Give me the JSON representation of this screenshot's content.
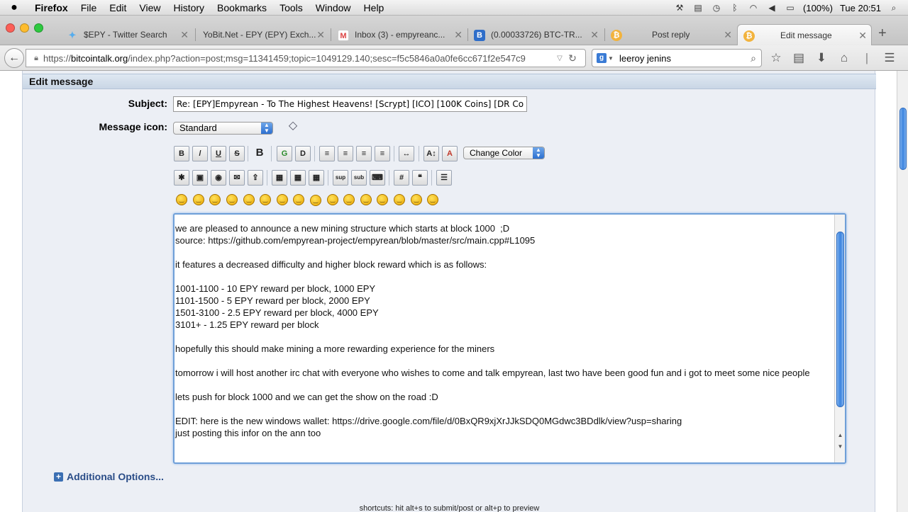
{
  "menubar": {
    "app": "Firefox",
    "items": [
      "File",
      "Edit",
      "View",
      "History",
      "Bookmarks",
      "Tools",
      "Window",
      "Help"
    ],
    "battery": "(100%)",
    "clock": "Tue 20:51"
  },
  "tabs": [
    {
      "label": "$EPY - Twitter Search",
      "icon": "twitter-bird-icon"
    },
    {
      "label": "YoBit.Net - EPY (EPY) Exch...",
      "icon": "none"
    },
    {
      "label": "Inbox (3) - empyreanc...",
      "icon": "gmail-icon"
    },
    {
      "label": "(0.00033726) BTC-TR...",
      "icon": "bittrex-icon"
    },
    {
      "label": "Post reply",
      "icon": "bitcoin-icon"
    },
    {
      "label": "Edit message",
      "icon": "bitcoin-icon"
    }
  ],
  "nav": {
    "url_prefix": "https://",
    "url_host": "bitcointalk.org",
    "url_rest": "/index.php?action=post;msg=11341459;topic=1049129.140;sesc=f5c5846a0a0fe6cc671f2e547c9",
    "search_value": "leeroy jenins"
  },
  "form": {
    "title": "Edit message",
    "subject_label": "Subject:",
    "subject_value": "Re: [EPY]Empyrean - To The Highest Heavens! [Scrypt] [ICO] [100K Coins] [DR Co",
    "message_icon_label": "Message icon:",
    "message_icon_value": "Standard",
    "change_color_label": "Change Color",
    "message_body": "we are pleased to announce a new mining structure which starts at block 1000  ;D\nsource: https://github.com/empyrean-project/empyrean/blob/master/src/main.cpp#L1095\n\nit features a decreased difficulty and higher block reward which is as follows:\n\n1001-1100 - 10 EPY reward per block, 1000 EPY\n1101-1500 - 5 EPY reward per block, 2000 EPY\n1501-3100 - 2.5 EPY reward per block, 4000 EPY\n3101+ - 1.25 EPY reward per block\n\nhopefully this should make mining a more rewarding experience for the miners\n\ntomorrow i will host another irc chat with everyone who wishes to come and talk empyrean, last two have been good fun and i got to meet some nice people\n\nlets push for block 1000 and we can get the show on the road :D\n\nEDIT: here is the new windows wallet: https://drive.google.com/file/d/0BxQR9xjXrJJkSDQ0MGdwc3BDdlk/view?usp=sharing\njust posting this infor on the ann too",
    "additional_options": "Additional Options...",
    "shortcuts": "shortcuts: hit alt+s to submit/post or alt+p to preview"
  },
  "toolbar_row1": [
    {
      "name": "bold-button",
      "glyph": "B"
    },
    {
      "name": "italic-button",
      "glyph": "/"
    },
    {
      "name": "underline-button",
      "glyph": "U"
    },
    {
      "name": "strikethrough-button",
      "glyph": "S"
    },
    {
      "name": "bitcoin-button",
      "glyph": "B"
    },
    {
      "name": "glow-button",
      "glyph": "G"
    },
    {
      "name": "shadow-button",
      "glyph": "D"
    },
    {
      "name": "align-left-button",
      "glyph": "≡"
    },
    {
      "name": "align-justify-button",
      "glyph": "≡"
    },
    {
      "name": "align-center-button",
      "glyph": "≡"
    },
    {
      "name": "align-right-button",
      "glyph": "≡"
    },
    {
      "name": "horizontal-rule-button",
      "glyph": "↔"
    },
    {
      "name": "font-size-button",
      "glyph": "A↕"
    },
    {
      "name": "font-face-button",
      "glyph": "A"
    }
  ],
  "toolbar_row2": [
    {
      "name": "flash-button",
      "glyph": "✱"
    },
    {
      "name": "image-button",
      "glyph": "▣"
    },
    {
      "name": "hyperlink-button",
      "glyph": "◉"
    },
    {
      "name": "email-button",
      "glyph": "✉"
    },
    {
      "name": "ftp-button",
      "glyph": "⇪"
    },
    {
      "name": "table-button",
      "glyph": "▦"
    },
    {
      "name": "table-row-button",
      "glyph": "▦"
    },
    {
      "name": "table-column-button",
      "glyph": "▦"
    },
    {
      "name": "superscript-button",
      "glyph": "sup"
    },
    {
      "name": "subscript-button",
      "glyph": "sub"
    },
    {
      "name": "teletype-button",
      "glyph": "⌨"
    },
    {
      "name": "code-button",
      "glyph": "#"
    },
    {
      "name": "quote-button",
      "glyph": "❝"
    },
    {
      "name": "list-button",
      "glyph": "☰"
    }
  ],
  "smileys": [
    "smiley",
    "wink",
    "cheesy",
    "grin",
    "angry",
    "sad",
    "shocked",
    "cool",
    "huh",
    "roll-eyes",
    "tongue",
    "embarrassed",
    "lips-sealed",
    "undecided",
    "kiss",
    "cry"
  ]
}
